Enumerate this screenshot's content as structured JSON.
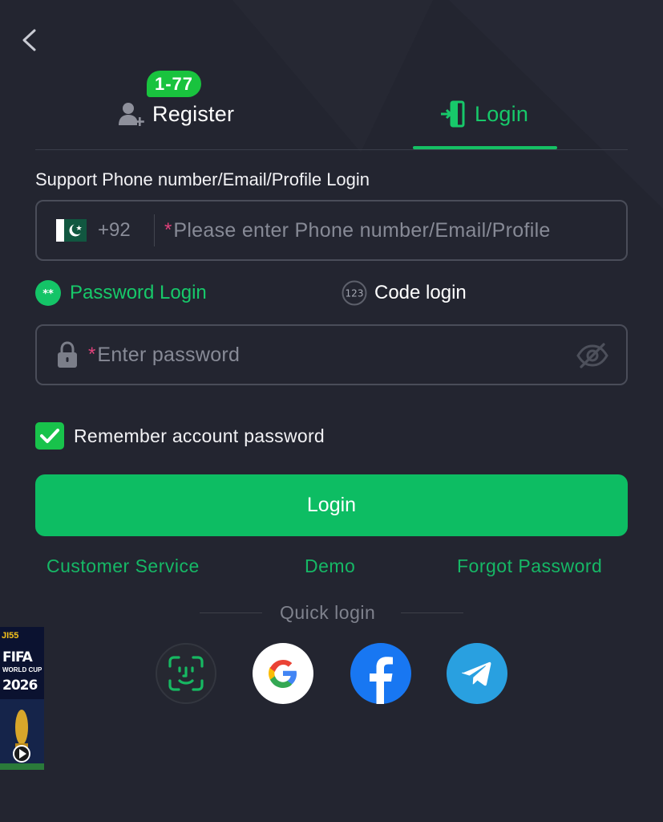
{
  "tabs": {
    "register": {
      "label": "Register",
      "badge": "1-77"
    },
    "login": {
      "label": "Login",
      "active": true
    }
  },
  "form": {
    "support_label": "Support Phone number/Email/Profile Login",
    "country_code": "+92",
    "required_mark": "*",
    "account_placeholder": "Please enter Phone number/Email/Profile",
    "password_placeholder": "Enter password"
  },
  "login_modes": {
    "password": {
      "label": "Password Login",
      "selected": true
    },
    "code": {
      "label": "Code login",
      "selected": false
    }
  },
  "remember": {
    "label": "Remember account password",
    "checked": true
  },
  "login_button": "Login",
  "links": {
    "customer_service": "Customer Service",
    "demo": "Demo",
    "forgot_password": "Forgot Password"
  },
  "quick_login": {
    "label": "Quick login",
    "providers": [
      "face-id",
      "google",
      "facebook",
      "telegram"
    ]
  },
  "promo_banner": {
    "title": "FIFA",
    "subtitle": "WORLD CUP",
    "year": "2026",
    "brand": "JI55"
  },
  "colors": {
    "background": "#232530",
    "accent": "#0dbd63",
    "badge": "#19c33e",
    "required": "#e0417a"
  }
}
